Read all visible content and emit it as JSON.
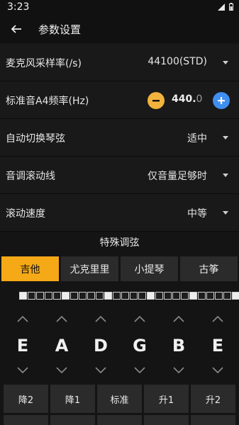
{
  "status": {
    "time": "3:23"
  },
  "header": {
    "title": "参数设置",
    "back_icon": "arrow-left-icon"
  },
  "settings": {
    "mic_rate": {
      "label": "麦克风采样率(/s)",
      "value": "44100(STD)"
    },
    "a4": {
      "label": "标准音A4频率(Hz)",
      "value_int": "440.",
      "value_dec": "0"
    },
    "auto_switch": {
      "label": "自动切换琴弦",
      "value": "适中"
    },
    "pitch_scroll": {
      "label": "音调滚动线",
      "value": "仅音量足够时"
    },
    "scroll_speed": {
      "label": "滚动速度",
      "value": "中等"
    }
  },
  "special_tuning": {
    "title": "特殊调弦",
    "tabs": [
      "吉他",
      "尤克里里",
      "小提琴",
      "古筝"
    ],
    "active_tab": 0
  },
  "strings": {
    "notes": [
      "E",
      "A",
      "D",
      "G",
      "B",
      "E"
    ]
  },
  "actions": [
    "降2",
    "降1",
    "标准",
    "升1",
    "升2"
  ],
  "colors": {
    "accent": "#f5a917",
    "minus": "#f2b33d",
    "plus": "#3f8ff0",
    "background": "#141414"
  }
}
